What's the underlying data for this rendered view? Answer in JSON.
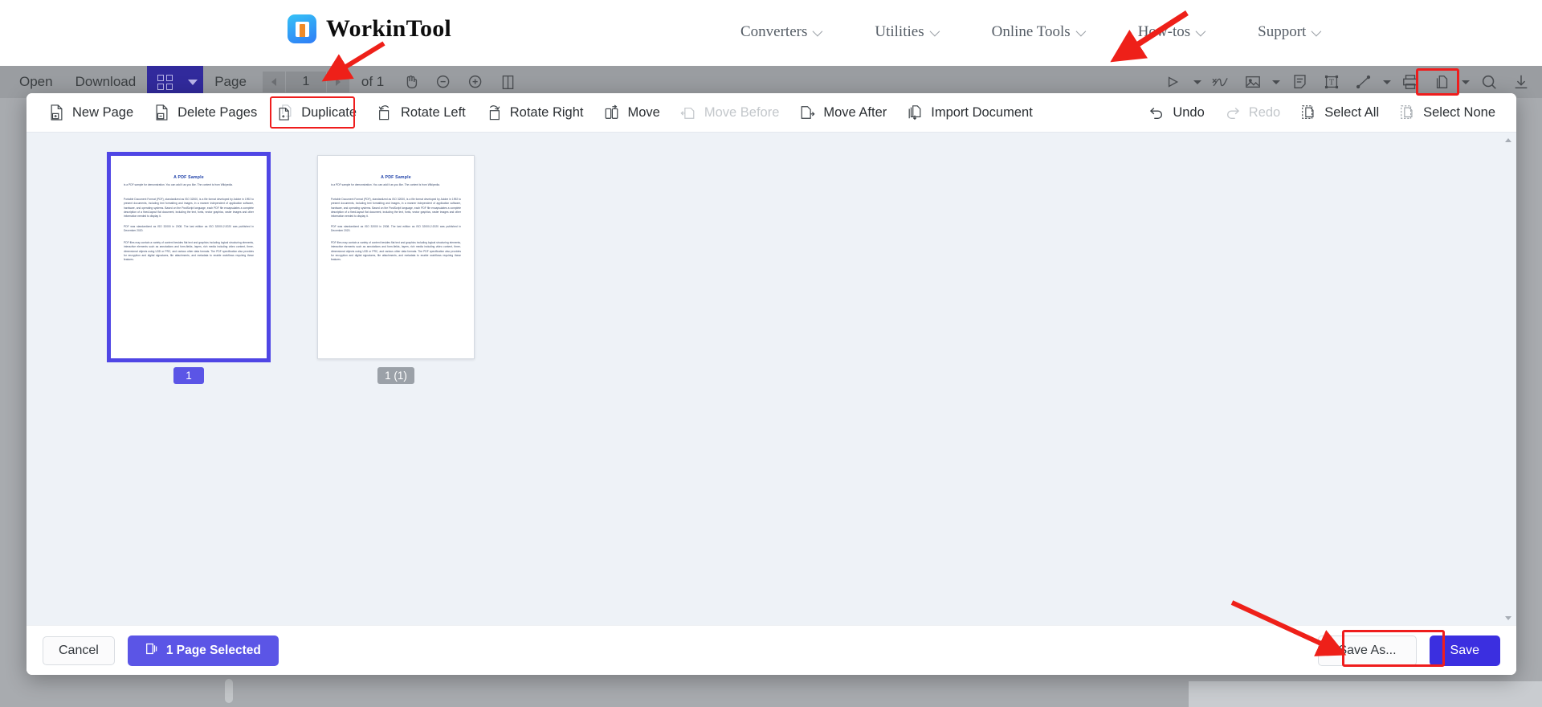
{
  "site_header": {
    "brand_name": "WorkinTool",
    "logo_icon": "workintool-logo-icon",
    "nav_items": [
      {
        "label": "Converters",
        "icon": "chevron-down-icon"
      },
      {
        "label": "Utilities",
        "icon": "chevron-down-icon"
      },
      {
        "label": "Online Tools",
        "icon": "chevron-down-icon"
      },
      {
        "label": "How-tos",
        "icon": "chevron-down-icon"
      },
      {
        "label": "Support",
        "icon": "chevron-down-icon"
      }
    ]
  },
  "app_toolbar": {
    "open_label": "Open",
    "download_label": "Download",
    "grid_view_icon": "grid-view-icon",
    "grid_view_caret_icon": "caret-down-icon",
    "page_label": "Page",
    "prev_page_icon": "triangle-left-icon",
    "page_value": "1",
    "next_page_icon": "triangle-right-icon",
    "page_total": "of 1",
    "hand_tool_icon": "hand-icon",
    "zoom_out_icon": "zoom-out-icon",
    "zoom_in_icon": "zoom-in-icon",
    "page_fit_icon": "page-fit-icon",
    "right_icons": [
      "highlighter-icon",
      "caret-down-icon",
      "signature-icon",
      "image-icon",
      "caret-down-icon",
      "note-icon",
      "text-box-icon",
      "line-shape-icon",
      "caret-down-icon",
      "print-icon",
      "organize-pages-icon",
      "caret-down-icon",
      "search-icon",
      "download-icon"
    ]
  },
  "modal": {
    "action_bar": [
      {
        "label": "New Page",
        "icon": "page-add-icon",
        "disabled": false,
        "highlighted": false
      },
      {
        "label": "Delete Pages",
        "icon": "page-delete-icon",
        "disabled": false,
        "highlighted": false
      },
      {
        "label": "Duplicate",
        "icon": "page-duplicate-icon",
        "disabled": false,
        "highlighted": true
      },
      {
        "label": "Rotate Left",
        "icon": "rotate-left-icon",
        "disabled": false,
        "highlighted": false
      },
      {
        "label": "Rotate Right",
        "icon": "rotate-right-icon",
        "disabled": false,
        "highlighted": false
      },
      {
        "label": "Move",
        "icon": "move-icon",
        "disabled": false,
        "highlighted": false
      },
      {
        "label": "Move Before",
        "icon": "move-before-icon",
        "disabled": true,
        "highlighted": false
      },
      {
        "label": "Move After",
        "icon": "move-after-icon",
        "disabled": false,
        "highlighted": false
      },
      {
        "label": "Import Document",
        "icon": "import-document-icon",
        "disabled": false,
        "highlighted": false
      }
    ],
    "action_bar_right": [
      {
        "label": "Undo",
        "icon": "undo-icon",
        "disabled": false
      },
      {
        "label": "Redo",
        "icon": "redo-icon",
        "disabled": true
      },
      {
        "label": "Select All",
        "icon": "select-all-icon",
        "disabled": false
      },
      {
        "label": "Select None",
        "icon": "select-none-icon",
        "disabled": false
      }
    ],
    "thumbnails": [
      {
        "badge": "1",
        "selected": true,
        "doc_title": "A PDF Sample",
        "doc_sub": "is a PDF sample for demonstration. You can add it as you like. The content is from Wikipedia.",
        "doc_p1": "Portable Document Format (PDF), standardized as ISO 32000, is a file format developed by Adobe in 1992 to present documents, including text formatting and images, in a manner independent of application software, hardware, and operating systems. Based on the PostScript language, each PDF file encapsulates a complete description of a fixed-layout flat document, including the text, fonts, vector graphics, raster images and other information needed to display it.",
        "doc_p2": "PDF was standardized as ISO 32000 in 2008. The last edition as ISO 32000-2:2020 was published in December 2020.",
        "doc_p3": "PDF files may contain a variety of content besides flat text and graphics including logical structuring elements, interactive elements such as annotations and form-fields, layers, rich media including video content, three-dimensional objects using U3D or PRC, and various other data formats. The PDF specification also provides for encryption and digital signatures, file attachments, and metadata to enable workflows requiring these features."
      },
      {
        "badge": "1 (1)",
        "selected": false,
        "doc_title": "A PDF Sample",
        "doc_sub": "is a PDF sample for demonstration. You can add it as you like. The content is from Wikipedia.",
        "doc_p1": "Portable Document Format (PDF), standardized as ISO 32000, is a file format developed by Adobe in 1992 to present documents, including text formatting and images, in a manner independent of application software, hardware, and operating systems. Based on the PostScript language, each PDF file encapsulates a complete description of a fixed-layout flat document, including the text, fonts, vector graphics, raster images and other information needed to display it.",
        "doc_p2": "PDF was standardized as ISO 32000 in 2008. The last edition as ISO 32000-2:2020 was published in December 2020.",
        "doc_p3": "PDF files may contain a variety of content besides flat text and graphics including logical structuring elements, interactive elements such as annotations and form-fields, layers, rich media including video content, three-dimensional objects using U3D or PRC, and various other data formats. The PDF specification also provides for encryption and digital signatures, file attachments, and metadata to enable workflows requiring these features."
      }
    ],
    "footer": {
      "cancel_label": "Cancel",
      "selection_label": "1 Page Selected",
      "selection_icon": "pages-icon",
      "save_as_label": "Save As...",
      "save_label": "Save"
    },
    "scrollbar_up_icon": "scroll-up-icon",
    "scrollbar_down_icon": "scroll-down-icon"
  },
  "annotations": {
    "arrow_color": "#ee2019",
    "highlight_color": "#ef1d1d",
    "arrows": [
      "arrow-to-organize-pages-icon",
      "arrow-to-duplicate-button",
      "arrow-to-save-as-button"
    ]
  }
}
